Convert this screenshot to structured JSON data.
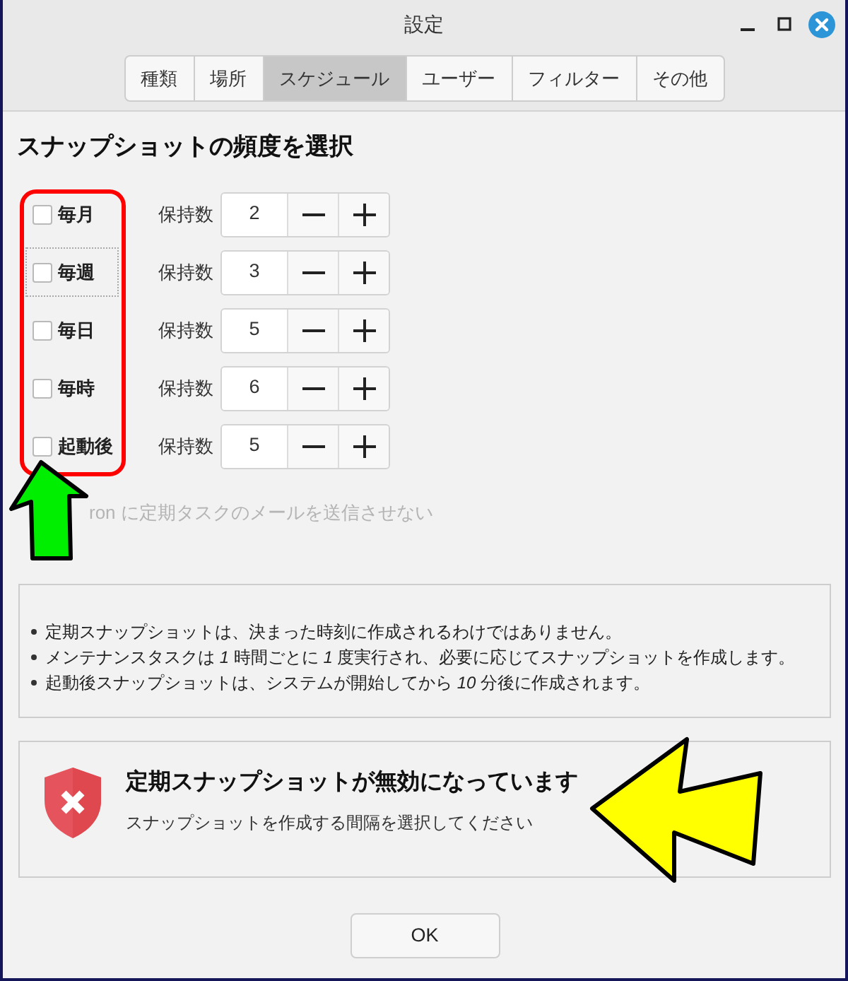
{
  "window": {
    "title": "設定"
  },
  "tabs": [
    {
      "label": "種類",
      "selected": false
    },
    {
      "label": "場所",
      "selected": false
    },
    {
      "label": "スケジュール",
      "selected": true
    },
    {
      "label": "ユーザー",
      "selected": false
    },
    {
      "label": "フィルター",
      "selected": false
    },
    {
      "label": "その他",
      "selected": false
    }
  ],
  "heading": "スナップショットの頻度を選択",
  "frequencies": [
    {
      "label": "毎月",
      "checked": false,
      "focused": false,
      "count_label": "保持数",
      "count": "2"
    },
    {
      "label": "毎週",
      "checked": false,
      "focused": true,
      "count_label": "保持数",
      "count": "3"
    },
    {
      "label": "毎日",
      "checked": false,
      "focused": false,
      "count_label": "保持数",
      "count": "5"
    },
    {
      "label": "毎時",
      "checked": false,
      "focused": false,
      "count_label": "保持数",
      "count": "6"
    },
    {
      "label": "起動後",
      "checked": false,
      "focused": false,
      "count_label": "保持数",
      "count": "5"
    }
  ],
  "cron_option": {
    "label": "ron に定期タスクのメールを送信させない",
    "disabled": true
  },
  "notes": [
    "定期スナップショットは、決まった時刻に作成されるわけではありません。",
    "メンテナンスタスクは *1* 時間ごとに *1* 度実行され、必要に応じてスナップショットを作成します。",
    "起動後スナップショットは、システムが開始してから *10* 分後に作成されます。"
  ],
  "alert": {
    "kind": "error",
    "title": "定期スナップショットが無効になっています",
    "message": "スナップショットを作成する間隔を選択してください"
  },
  "buttons": [
    {
      "label": "OK"
    }
  ],
  "annotations": [
    {
      "kind": "frame",
      "color": "#ff0000"
    },
    {
      "kind": "uparrow",
      "color": "#00ee00"
    },
    {
      "kind": "leftarrow",
      "color": "#ffff00"
    }
  ]
}
